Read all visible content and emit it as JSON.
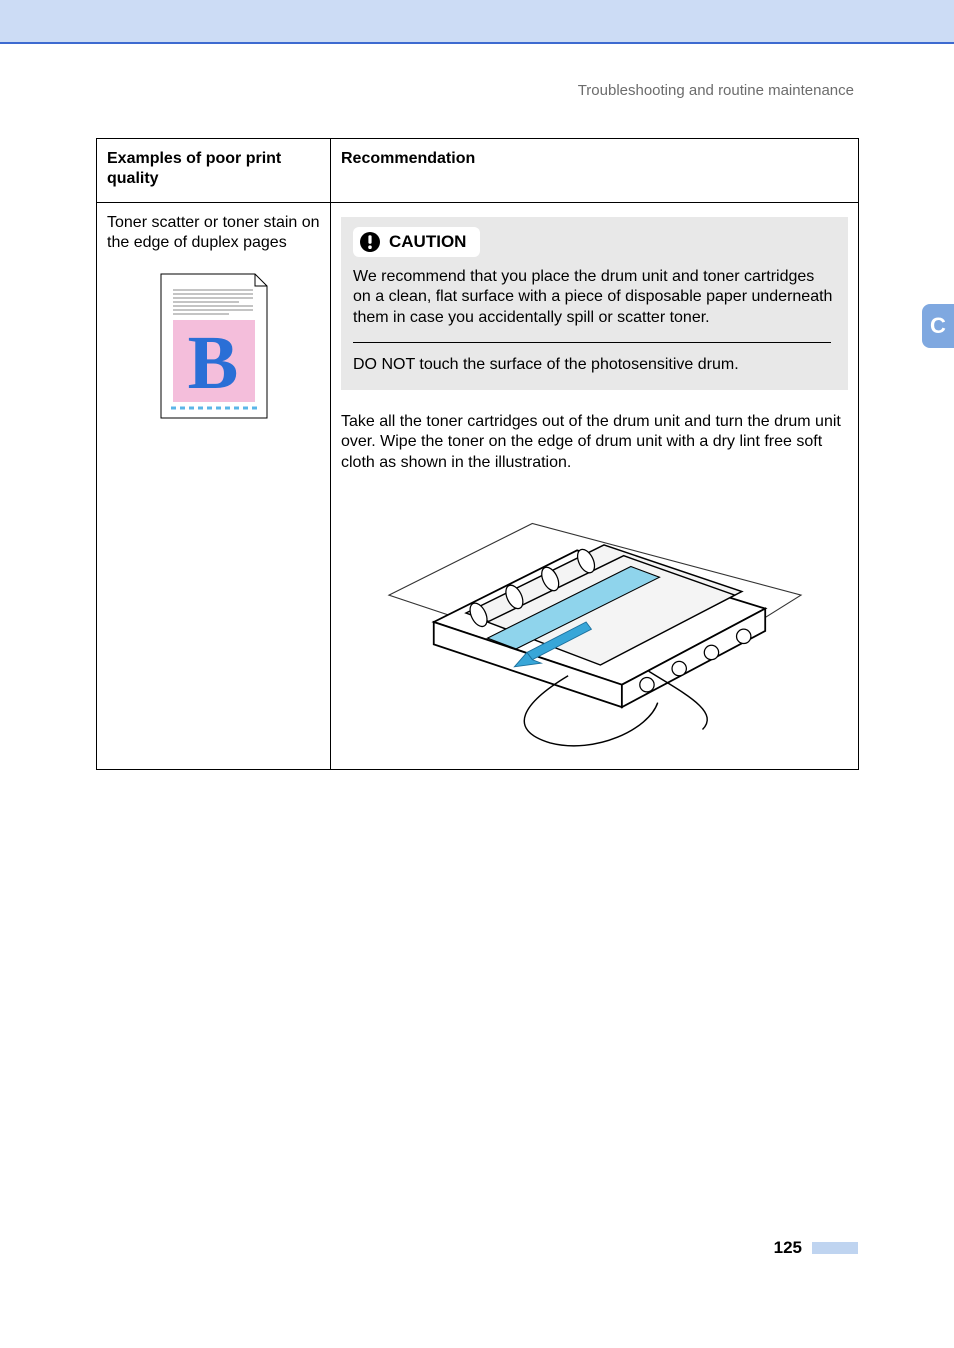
{
  "header": {
    "section_title": "Troubleshooting and routine maintenance"
  },
  "side_tab": {
    "letter": "C"
  },
  "table": {
    "headers": {
      "left": "Examples of poor print quality",
      "right": "Recommendation"
    },
    "row": {
      "problem": "Toner scatter or toner stain on the edge of duplex pages",
      "sample_letter": "B",
      "caution": {
        "title": "CAUTION",
        "para1": "We recommend that you place the drum unit and toner cartridges on a clean, flat surface with a piece of disposable paper underneath them in case you accidentally spill or scatter toner.",
        "para2": "DO NOT touch the surface of the photosensitive drum."
      },
      "instruction": "Take all the toner cartridges out of the drum unit and turn the drum unit over. Wipe the toner on the edge of drum unit with a dry lint free soft cloth as shown in the illustration."
    }
  },
  "footer": {
    "page_number": "125"
  }
}
